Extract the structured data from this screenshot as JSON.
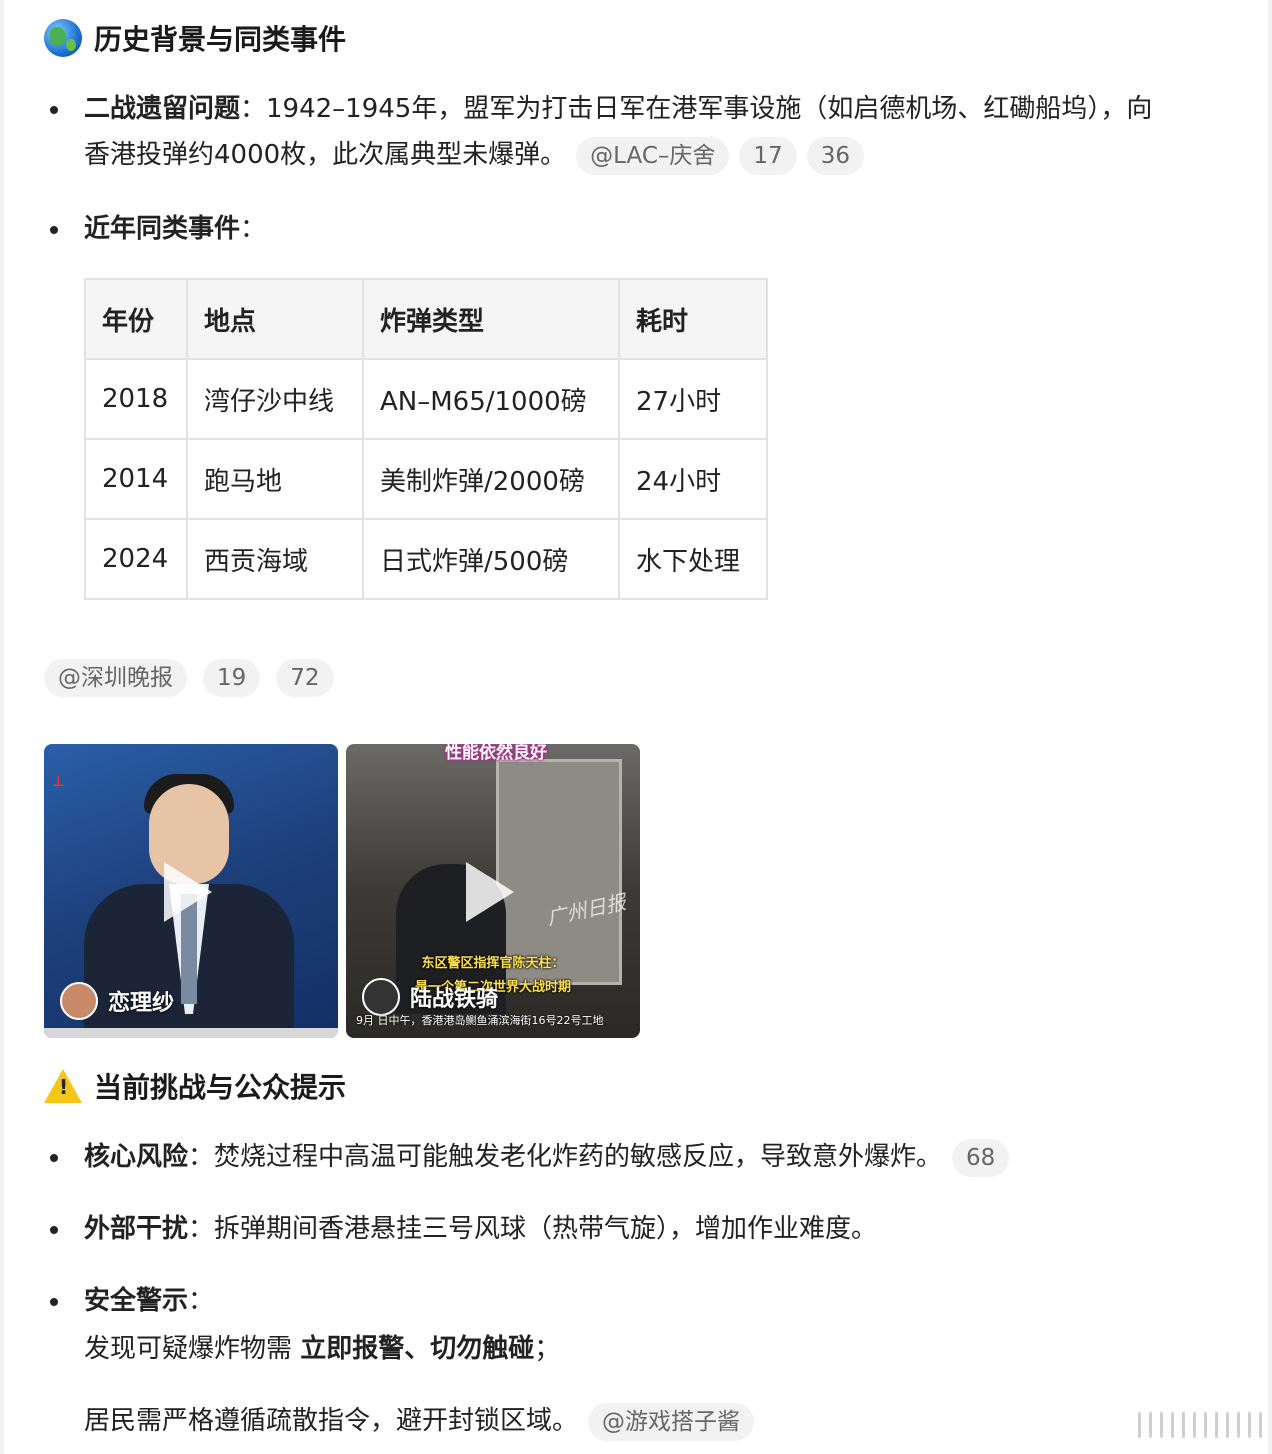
{
  "section1": {
    "title": "历史背景与同类事件",
    "icon": "globe-icon"
  },
  "bullet1": {
    "label": "二战遗留问题",
    "text_line1": "：1942–1945年，盟军为打击日军在港军事设施（如启德机场、红磡船坞），向",
    "text_line2": "香港投弹约4000枚，此次属典型未爆弹。",
    "source": "@LAC–庆舍",
    "ref1": "17",
    "ref2": "36"
  },
  "bullet2": {
    "label": "近年同类事件",
    "suffix": "："
  },
  "table": {
    "headers": [
      "年份",
      "地点",
      "炸弹类型",
      "耗时"
    ],
    "rows": [
      [
        "2018",
        "湾仔沙中线",
        "AN–M65/1000磅",
        "27小时"
      ],
      [
        "2014",
        "跑马地",
        "美制炸弹/2000磅",
        "24小时"
      ],
      [
        "2024",
        "西贡海域",
        "日式炸弹/500磅",
        "水下处理"
      ]
    ]
  },
  "source_row": {
    "source": "@深圳晚报",
    "ref1": "19",
    "ref2": "72"
  },
  "videos": [
    {
      "caption": "恋理纱"
    },
    {
      "caption": "陆战铁骑",
      "banner": "性能依然良好",
      "sub1": "东区警区指挥官陈天柱：",
      "sub2": "是一个第二次世界大战时期",
      "sub3": "9月  日中午，香港港岛鲗鱼涌滨海街16号22号工地",
      "watermark": "广州日报"
    }
  ],
  "section2": {
    "title": "当前挑战与公众提示",
    "icon": "warning-icon"
  },
  "bullet3": {
    "label": "核心风险",
    "text": "：焚烧过程中高温可能触发老化炸药的敏感反应，导致意外爆炸。",
    "ref": "68"
  },
  "bullet4": {
    "label": "外部干扰",
    "text": "：拆弹期间香港悬挂三号风球（热带气旋），增加作业难度。"
  },
  "bullet5": {
    "label": "安全警示",
    "suffix": "：",
    "line1_prefix": "发现可疑爆炸物需 ",
    "line1_bold": "立即报警、切勿触碰",
    "line1_suffix": "；",
    "line2": "居民需严格遵循疏散指令，避开封锁区域。",
    "source": "@游戏搭子酱"
  }
}
